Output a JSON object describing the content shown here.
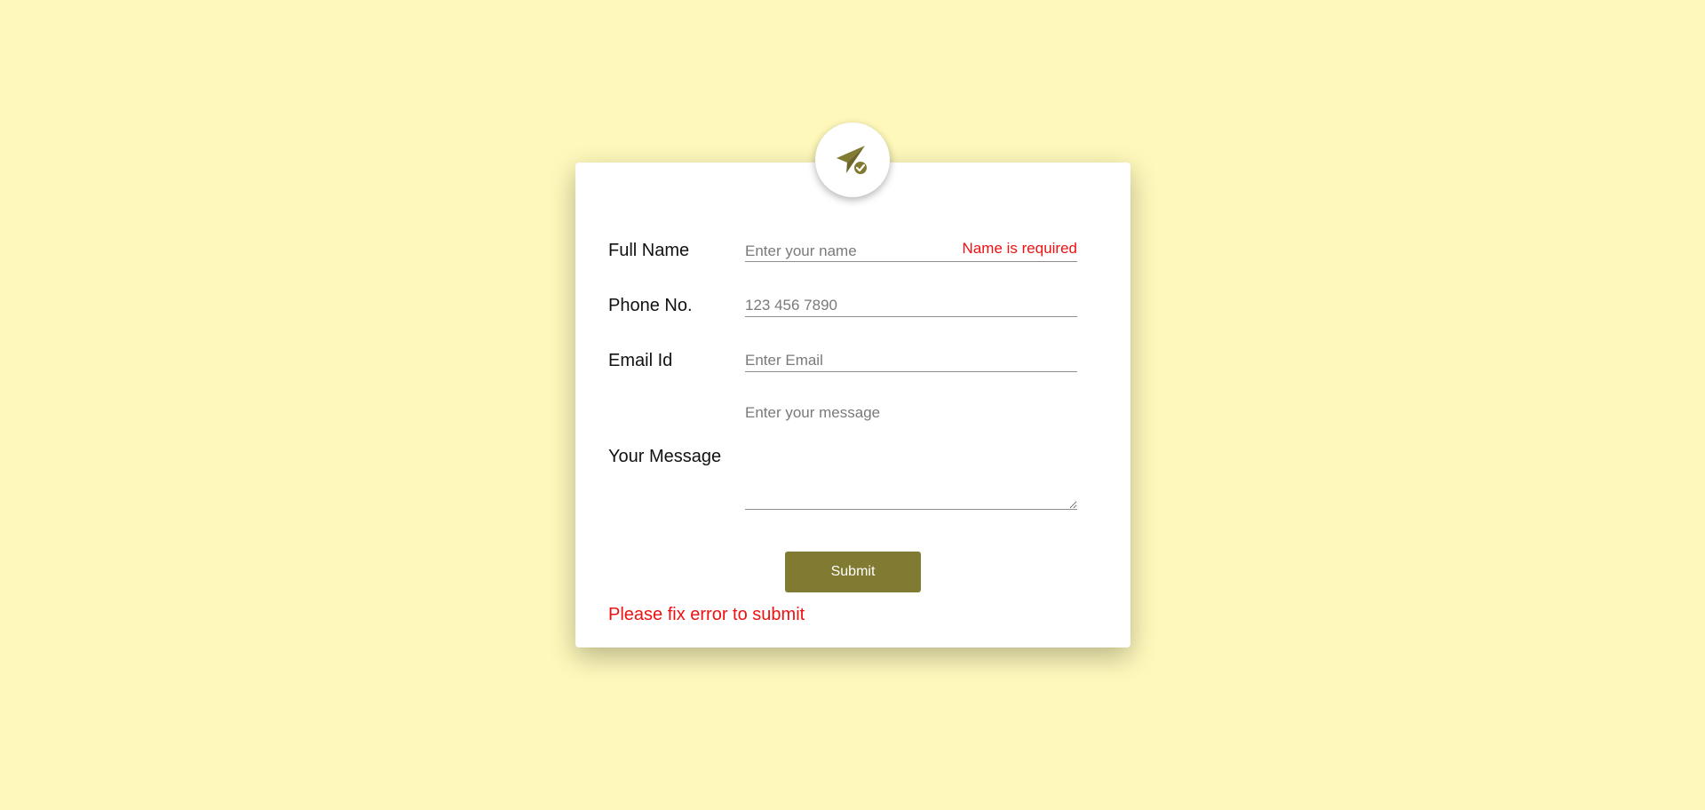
{
  "theme": {
    "background": "#fef8bb",
    "accent": "#817a32",
    "error": "#ee1111"
  },
  "header": {
    "icon": "paper-plane-check-icon"
  },
  "form": {
    "fields": [
      {
        "label": "Full Name",
        "placeholder": "Enter your name",
        "value": "",
        "error": "Name is required"
      },
      {
        "label": "Phone No.",
        "placeholder": "123 456 7890",
        "value": ""
      },
      {
        "label": "Email Id",
        "placeholder": "Enter Email",
        "value": ""
      },
      {
        "label": "Your Message",
        "placeholder": "Enter your message",
        "value": ""
      }
    ],
    "submit_label": "Submit",
    "form_error": "Please fix error to submit"
  }
}
